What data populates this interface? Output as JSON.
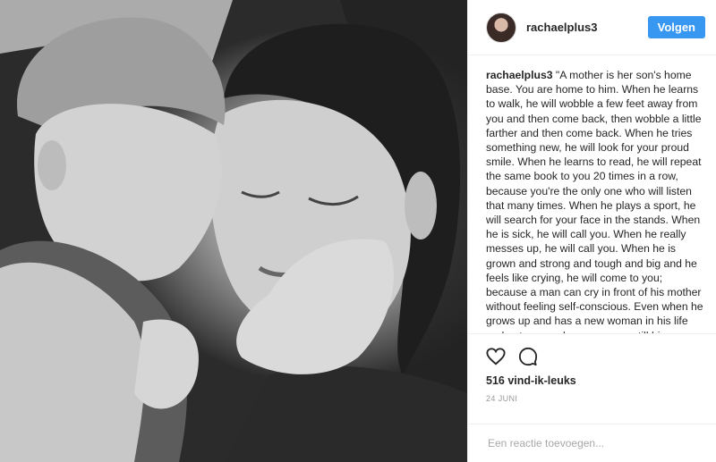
{
  "profile": {
    "username": "rachaelplus3",
    "follow_label": "Volgen"
  },
  "caption": {
    "username": "rachaelplus3",
    "text": "\"A mother is her son's home base. You are home to him. When he learns to walk, he will wobble a few feet away from you and then come back, then wobble a little farther and then come back. When he tries something new, he will look for your proud smile. When he learns to read, he will repeat the same book to you 20 times in a row, because you're the only one who will listen that many times. When he plays a sport, he will search for your face in the stands. When he is sick, he will call you. When he really messes up, he will call you. When he is grown and strong and tough and big and he feels like crying, he will come to you; because a man can cry in front of his mother without feeling self-conscious. Even when he grows up and has a new woman in his life and gets a new home you are still his mother; homebase, the ever"
  },
  "actions": {
    "like_icon": "heart-icon",
    "comment_icon": "comment-icon"
  },
  "likes": "516 vind-ik-leuks",
  "date": "24 JUNI",
  "comment": {
    "placeholder": "Een reactie toevoegen..."
  },
  "colors": {
    "accent": "#3897f0",
    "text": "#262626",
    "muted": "#999999"
  }
}
